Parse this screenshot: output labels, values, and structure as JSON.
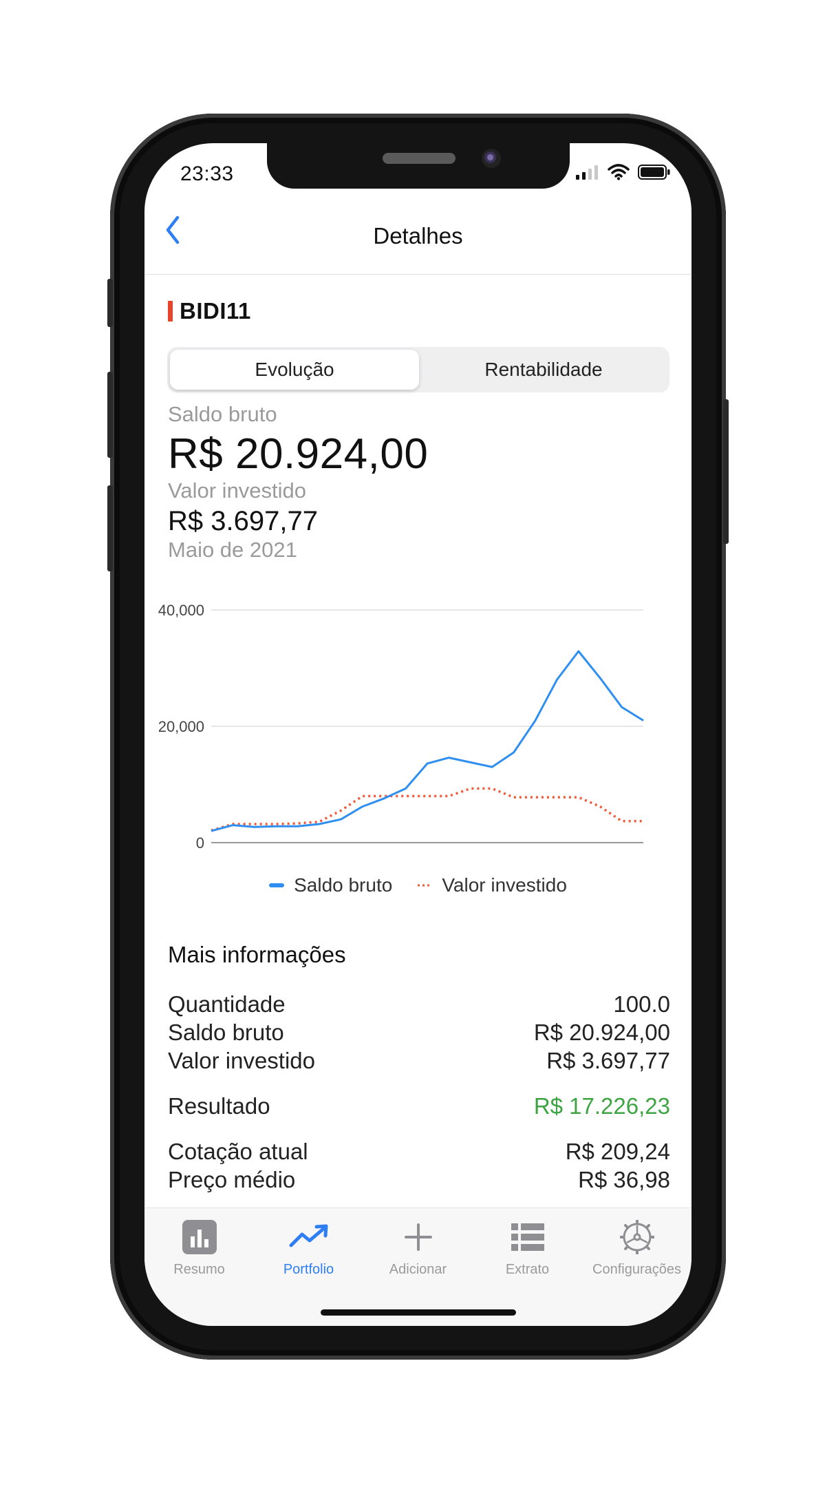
{
  "status": {
    "time": "23:33"
  },
  "nav": {
    "title": "Detalhes"
  },
  "asset": {
    "ticker": "BIDI11"
  },
  "tabs": {
    "active": "Evolução",
    "inactive": "Rentabilidade"
  },
  "summary": {
    "gross_label": "Saldo bruto",
    "gross_value": "R$ 20.924,00",
    "invested_label": "Valor investido",
    "invested_value": "R$ 3.697,77",
    "period": "Maio de 2021"
  },
  "chart_data": {
    "type": "line",
    "x": [
      0,
      1,
      2,
      3,
      4,
      5,
      6,
      7,
      8,
      9,
      10,
      11,
      12,
      13,
      14,
      15,
      16,
      17,
      18,
      19,
      20
    ],
    "ylim": [
      0,
      40000
    ],
    "yticks": [
      "40,000",
      "20,000",
      "0"
    ],
    "grid": true,
    "legend_position": "bottom",
    "series": [
      {
        "name": "Saldo bruto",
        "color": "#2f8ff0",
        "style": "solid",
        "values": [
          2000,
          3000,
          2700,
          2800,
          2800,
          3200,
          4000,
          6200,
          7600,
          9300,
          13600,
          14600,
          13800,
          13000,
          15500,
          21000,
          28000,
          32900,
          28300,
          23300,
          21000
        ]
      },
      {
        "name": "Valor investido",
        "color": "#f05a3a",
        "style": "dotted",
        "values": [
          2100,
          3200,
          3200,
          3200,
          3300,
          3600,
          5500,
          8000,
          8000,
          8000,
          8000,
          8000,
          9300,
          9300,
          7800,
          7800,
          7800,
          7800,
          6200,
          3700,
          3700
        ]
      }
    ]
  },
  "info": {
    "title": "Mais informações",
    "rows": [
      {
        "label": "Quantidade",
        "value": "100.0"
      },
      {
        "label": "Saldo bruto",
        "value": "R$ 20.924,00"
      },
      {
        "label": "Valor investido",
        "value": "R$ 3.697,77"
      },
      {
        "label": "Resultado",
        "value": "R$ 17.226,23"
      },
      {
        "label": "Cotação atual",
        "value": "R$ 209,24"
      },
      {
        "label": "Preço médio",
        "value": "R$ 36,98"
      }
    ],
    "positive_color": "#3ea443"
  },
  "tabbar": {
    "items": [
      {
        "label": "Resumo",
        "icon": "bar-chart-icon"
      },
      {
        "label": "Portfolio",
        "icon": "trend-up-icon"
      },
      {
        "label": "Adicionar",
        "icon": "plus-icon"
      },
      {
        "label": "Extrato",
        "icon": "list-icon"
      },
      {
        "label": "Configurações",
        "icon": "gear-icon"
      }
    ],
    "active_color": "#2f7ef4"
  }
}
